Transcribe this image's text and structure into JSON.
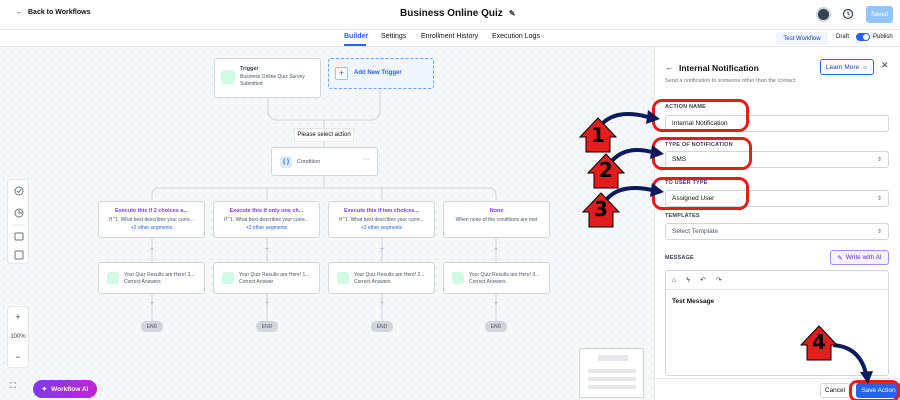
{
  "topbar": {
    "back_label": "Back to Workflows",
    "title": "Business Online Quiz",
    "saved_label": "Saved"
  },
  "tabs": [
    {
      "label": "Builder",
      "active": true
    },
    {
      "label": "Settings"
    },
    {
      "label": "Enrollment History"
    },
    {
      "label": "Execution Logs"
    }
  ],
  "tabbar_right": {
    "test_workflow": "Test Workflow",
    "draft": "Draft",
    "publish": "Publish"
  },
  "canvas": {
    "trigger": {
      "label": "Trigger",
      "desc": "Business Online Quiz Survey Submitted"
    },
    "add_trigger": "Add New Trigger",
    "please_select": "Please select action",
    "condition": "Condition",
    "branches": [
      {
        "title": "Execute this if 2 choices a...",
        "sub": "If \"1. What best describes your curre...",
        "other": "+2 other segments"
      },
      {
        "title": "Execute this if only one ch...",
        "sub": "If \"1. What best describes your curre...",
        "other": "+2 other segments"
      },
      {
        "title": "Execute this if two choices...",
        "sub": "If \"1. What best describes your curre...",
        "other": "+2 other segments"
      },
      {
        "title": "None",
        "sub": "When none of the conditions are met",
        "other": ""
      }
    ],
    "actions": [
      "Your Quiz Results are Here! 3... Correct Answers",
      "Your Quiz Results are Here! 1... Correct Answer",
      "Your Quiz Results are Here! 2... Correct Answers",
      "Your Quiz Results are Here! 0... Correct Answers"
    ],
    "end_label": "END",
    "zoom": {
      "plus": "+",
      "level": "100%",
      "minus": "−"
    },
    "workflow_ai": "Workflow AI"
  },
  "panel": {
    "title": "Internal Notification",
    "learn_more": "Learn More",
    "subtitle": "Send a notification to someone other than the contact",
    "action_name_label": "ACTION NAME",
    "action_name_value": "Internal Notification",
    "type_label": "TYPE OF NOTIFICATION",
    "type_value": "SMS",
    "user_type_label": "TO USER TYPE",
    "user_type_value": "Assigned User",
    "templates_label": "TEMPLATES",
    "templates_placeholder": "Select Template",
    "message_label": "MESSAGE",
    "write_ai": "Write with AI",
    "message_value": "Test Message",
    "cancel": "Cancel",
    "save_action": "Save Action"
  },
  "annotations": {
    "steps": [
      "1",
      "2",
      "3",
      "4"
    ],
    "color": "#e11d1d"
  }
}
